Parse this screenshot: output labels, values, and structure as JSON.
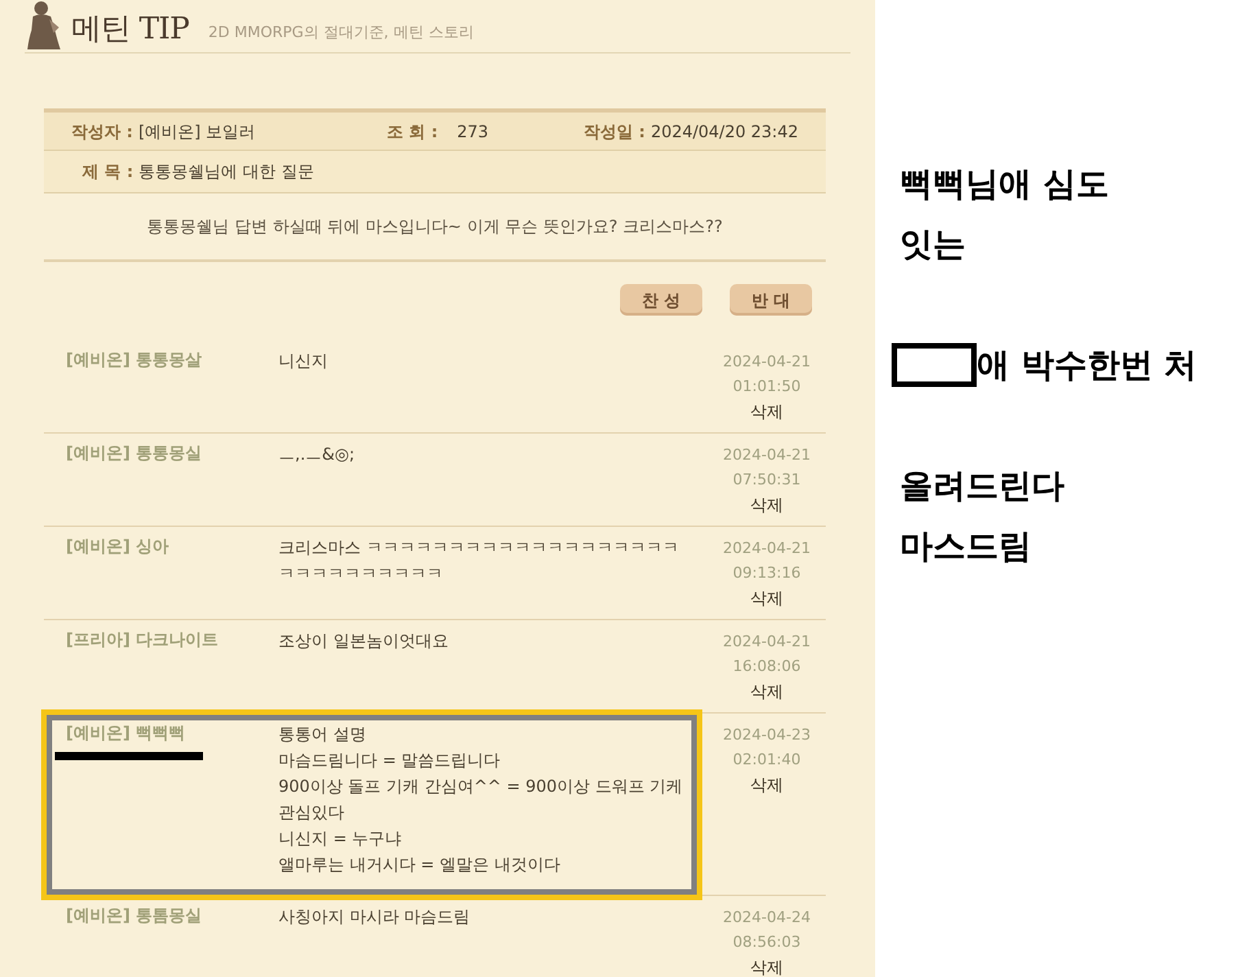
{
  "header": {
    "title": "메틴 TIP",
    "subtitle": "2D MMORPG의 절대기준, 메틴 스토리"
  },
  "post": {
    "author_label": "작성자 :",
    "author": "[예비온] 보일러",
    "views_label": "조 회 :",
    "views": "273",
    "date_label": "작성일 :",
    "date": "2024/04/20 23:42",
    "subject_label": "제 목 :",
    "subject": "통통몽쉘님에 대한 질문",
    "body": "통통몽쉘님 답변 하실때 뒤에 마스입니다~ 이게 무슨 뜻인가요? 크리스마스??"
  },
  "vote_buttons": [
    "찬 성",
    "반 대"
  ],
  "comments": [
    {
      "author": "[예비온] 통통몽살",
      "lines": [
        "니신지"
      ],
      "date": "2024-04-21",
      "time": "01:01:50",
      "action": "삭제",
      "highlighted": false,
      "redacted": false
    },
    {
      "author": "[예비온] 통통몽실",
      "lines": [
        "ㅡ,.ㅡ&◎;"
      ],
      "date": "2024-04-21",
      "time": "07:50:31",
      "action": "삭제",
      "highlighted": false,
      "redacted": false
    },
    {
      "author": "[예비온] 싱아",
      "lines": [
        "크리스마스 ㅋㅋㅋㅋㅋㅋㅋㅋㅋㅋㅋㅋㅋㅋㅋㅋㅋㅋㅋㅋㅋㅋㅋㅋㅋㅋㅋㅋㅋ"
      ],
      "date": "2024-04-21",
      "time": "09:13:16",
      "action": "삭제",
      "highlighted": false,
      "redacted": false
    },
    {
      "author": "[프리아] 다크나이트",
      "lines": [
        "조상이 일본놈이엇대요"
      ],
      "date": "2024-04-21",
      "time": "16:08:06",
      "action": "삭제",
      "highlighted": false,
      "redacted": false
    },
    {
      "author": "[예비온] 뻑뻑뻑",
      "lines": [
        "통통어 설명",
        "마슴드림니다 = 말씀드립니다",
        "900이상 돌프 기캐 간심여^^ = 900이상 드워프 기케 관심있다",
        "니신지 = 누구냐",
        "앨마루는 내거시다 = 엘말은 내것이다"
      ],
      "date": "2024-04-23",
      "time": "02:01:40",
      "action": "삭제",
      "highlighted": true,
      "redacted": true
    },
    {
      "author": "[예비온] 통톰몽실",
      "lines": [
        "사칭아지 마시라 마슴드림"
      ],
      "date": "2024-04-24",
      "time": "08:56:03",
      "action": "삭제",
      "highlighted": false,
      "redacted": false
    }
  ],
  "annotation": [
    {
      "lines": [
        {
          "text": "뻑뻑님애 심도",
          "boxed_blank": false
        },
        {
          "text": "잇는",
          "boxed_blank": false
        }
      ]
    },
    {
      "lines": [
        {
          "text": "애 박수한번 처",
          "boxed_blank": true
        }
      ]
    },
    {
      "lines": [
        {
          "text": "올려드린다",
          "boxed_blank": false
        },
        {
          "text": "마스드림",
          "boxed_blank": false
        }
      ]
    }
  ]
}
